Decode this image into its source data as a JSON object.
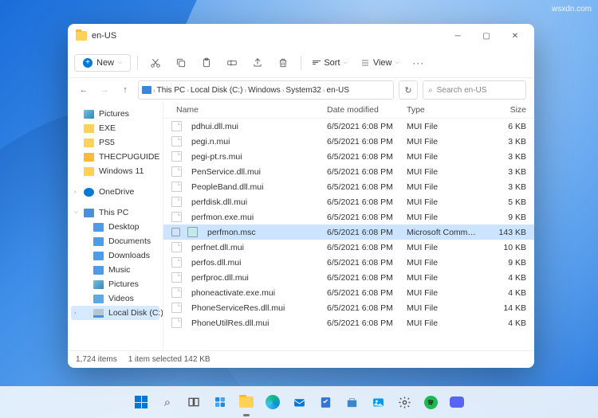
{
  "watermark": "wsxdn.com",
  "window": {
    "title": "en-US"
  },
  "toolbar": {
    "new": "New",
    "sort": "Sort",
    "view": "View"
  },
  "breadcrumb": [
    "This PC",
    "Local Disk (C:)",
    "Windows",
    "System32",
    "en-US"
  ],
  "search": {
    "placeholder": "Search en-US"
  },
  "sidebar": {
    "quick": [
      {
        "label": "Pictures",
        "icon": "ico-pic"
      },
      {
        "label": "EXE",
        "icon": "ico-folder"
      },
      {
        "label": "PS5",
        "icon": "ico-folder"
      },
      {
        "label": "THECPUGUIDE",
        "icon": "ico-folder-y"
      },
      {
        "label": "Windows 11",
        "icon": "ico-folder"
      }
    ],
    "onedrive": "OneDrive",
    "thispc": {
      "label": "This PC",
      "items": [
        {
          "label": "Desktop",
          "icon": "ico-blue"
        },
        {
          "label": "Documents",
          "icon": "ico-blue"
        },
        {
          "label": "Downloads",
          "icon": "ico-blue"
        },
        {
          "label": "Music",
          "icon": "ico-blue"
        },
        {
          "label": "Pictures",
          "icon": "ico-pic"
        },
        {
          "label": "Videos",
          "icon": "ico-video"
        },
        {
          "label": "Local Disk (C:)",
          "icon": "ico-disk",
          "selected": true
        }
      ]
    }
  },
  "columns": {
    "name": "Name",
    "date": "Date modified",
    "type": "Type",
    "size": "Size"
  },
  "files": [
    {
      "name": "pdhui.dll.mui",
      "date": "6/5/2021 6:08 PM",
      "type": "MUI File",
      "size": "6 KB"
    },
    {
      "name": "pegi.n.mui",
      "date": "6/5/2021 6:08 PM",
      "type": "MUI File",
      "size": "3 KB"
    },
    {
      "name": "pegi-pt.rs.mui",
      "date": "6/5/2021 6:08 PM",
      "type": "MUI File",
      "size": "3 KB"
    },
    {
      "name": "PenService.dll.mui",
      "date": "6/5/2021 6:08 PM",
      "type": "MUI File",
      "size": "3 KB"
    },
    {
      "name": "PeopleBand.dll.mui",
      "date": "6/5/2021 6:08 PM",
      "type": "MUI File",
      "size": "3 KB"
    },
    {
      "name": "perfdisk.dll.mui",
      "date": "6/5/2021 6:08 PM",
      "type": "MUI File",
      "size": "5 KB"
    },
    {
      "name": "perfmon.exe.mui",
      "date": "6/5/2021 6:08 PM",
      "type": "MUI File",
      "size": "9 KB"
    },
    {
      "name": "perfmon.msc",
      "date": "6/5/2021 6:08 PM",
      "type": "Microsoft Comm…",
      "size": "143 KB",
      "selected": true
    },
    {
      "name": "perfnet.dll.mui",
      "date": "6/5/2021 6:08 PM",
      "type": "MUI File",
      "size": "10 KB"
    },
    {
      "name": "perfos.dll.mui",
      "date": "6/5/2021 6:08 PM",
      "type": "MUI File",
      "size": "9 KB"
    },
    {
      "name": "perfproc.dll.mui",
      "date": "6/5/2021 6:08 PM",
      "type": "MUI File",
      "size": "4 KB"
    },
    {
      "name": "phoneactivate.exe.mui",
      "date": "6/5/2021 6:08 PM",
      "type": "MUI File",
      "size": "4 KB"
    },
    {
      "name": "PhoneServiceRes.dll.mui",
      "date": "6/5/2021 6:08 PM",
      "type": "MUI File",
      "size": "14 KB"
    },
    {
      "name": "PhoneUtilRes.dll.mui",
      "date": "6/5/2021 6:08 PM",
      "type": "MUI File",
      "size": "4 KB"
    }
  ],
  "status": {
    "count": "1,724 items",
    "selected": "1 item selected   142 KB"
  }
}
